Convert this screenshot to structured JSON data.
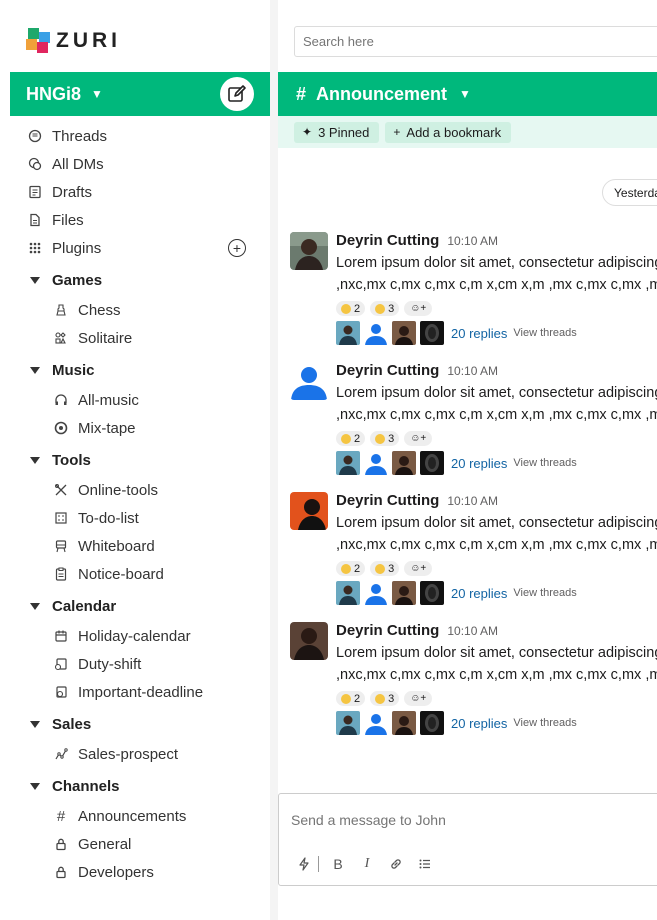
{
  "brand": {
    "name": "ZURI",
    "colors": [
      "#1ea86b",
      "#3aa0e6",
      "#f0a13a",
      "#e0265f"
    ]
  },
  "workspace": {
    "name": "HNGi8"
  },
  "sidebar": {
    "top_items": [
      {
        "label": "Threads",
        "icon": "threads-icon"
      },
      {
        "label": "All DMs",
        "icon": "dms-icon"
      },
      {
        "label": "Drafts",
        "icon": "drafts-icon"
      },
      {
        "label": "Files",
        "icon": "files-icon"
      },
      {
        "label": "Plugins",
        "icon": "plugins-icon"
      }
    ],
    "groups": [
      {
        "label": "Games",
        "items": [
          {
            "label": "Chess",
            "icon": "chess-icon"
          },
          {
            "label": "Solitaire",
            "icon": "solitaire-icon"
          }
        ]
      },
      {
        "label": "Music",
        "items": [
          {
            "label": "All-music",
            "icon": "headphones-icon"
          },
          {
            "label": "Mix-tape",
            "icon": "disc-icon"
          }
        ]
      },
      {
        "label": "Tools",
        "items": [
          {
            "label": "Online-tools",
            "icon": "tools-icon"
          },
          {
            "label": "To-do-list",
            "icon": "checklist-icon"
          },
          {
            "label": "Whiteboard",
            "icon": "whiteboard-icon"
          },
          {
            "label": "Notice-board",
            "icon": "clipboard-icon"
          }
        ]
      },
      {
        "label": "Calendar",
        "items": [
          {
            "label": "Holiday-calendar",
            "icon": "calendar-icon"
          },
          {
            "label": "Duty-shift",
            "icon": "duty-icon"
          },
          {
            "label": "Important-deadline",
            "icon": "deadline-icon"
          }
        ]
      },
      {
        "label": "Sales",
        "items": [
          {
            "label": "Sales-prospect",
            "icon": "chart-line-icon"
          }
        ]
      },
      {
        "label": "Channels",
        "items": [
          {
            "label": "Announcements",
            "icon": "hash-icon"
          },
          {
            "label": "General",
            "icon": "lock-icon"
          },
          {
            "label": "Developers",
            "icon": "lock-icon"
          }
        ]
      }
    ]
  },
  "search": {
    "placeholder": "Search here"
  },
  "channel": {
    "name": "Announcement",
    "hash": "#",
    "pinned_label": "3 Pinned",
    "bookmark_label": "Add a bookmark",
    "day_divider": "Yesterday"
  },
  "messages": [
    {
      "author": "Deyrin Cutting",
      "time": "10:10 AM",
      "line1": "Lorem ipsum dolor sit amet, consectetur adipiscing elit",
      "line2": ",nxc,mx c,mx c,mx c,m x,cm x,m ,mx c,mx c,mx  ,mx",
      "reactions": [
        "2",
        "3"
      ],
      "replies": "20 replies",
      "view": "View threads",
      "avatar": "photo"
    },
    {
      "author": "Deyrin Cutting",
      "time": "10:10 AM",
      "line1": "Lorem ipsum dolor sit amet, consectetur adipiscing elit",
      "line2": ",nxc,mx c,mx c,mx c,m x,cm x,m ,mx c,mx c,mx  ,mx",
      "reactions": [
        "2",
        "3"
      ],
      "replies": "20 replies",
      "view": "View threads",
      "avatar": "default"
    },
    {
      "author": "Deyrin Cutting",
      "time": "10:10 AM",
      "line1": "Lorem ipsum dolor sit amet, consectetur adipiscing elit",
      "line2": ",nxc,mx c,mx c,mx c,m x,cm x,m ,mx c,mx c,mx  ,mx",
      "reactions": [
        "2",
        "3"
      ],
      "replies": "20 replies",
      "view": "View threads",
      "avatar": "orange"
    },
    {
      "author": "Deyrin Cutting",
      "time": "10:10 AM",
      "line1": "Lorem ipsum dolor sit amet, consectetur adipiscing elit",
      "line2": ",nxc,mx c,mx c,mx c,m x,cm x,m ,mx c,mx c,mx  ,mx",
      "reactions": [
        "2",
        "3"
      ],
      "replies": "20 replies",
      "view": "View threads",
      "avatar": "photo2"
    }
  ],
  "composer": {
    "placeholder": "Send a message to John"
  },
  "theme": {
    "accent": "#00b87c",
    "accent_light": "#e6f8f2",
    "link": "#1264a3"
  }
}
